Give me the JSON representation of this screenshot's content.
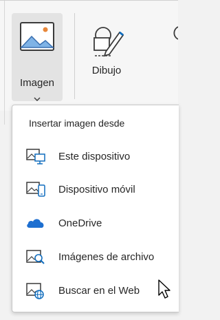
{
  "ribbon": {
    "imagen_label": "Imagen",
    "dibujo_label": "Dibujo"
  },
  "menu": {
    "header": "Insertar imagen desde",
    "items": [
      {
        "label": "Este dispositivo",
        "icon": "device-image-icon"
      },
      {
        "label": "Dispositivo móvil",
        "icon": "mobile-image-icon"
      },
      {
        "label": "OneDrive",
        "icon": "onedrive-cloud-icon"
      },
      {
        "label": "Imágenes de archivo",
        "icon": "stock-image-search-icon"
      },
      {
        "label": "Buscar en el Web",
        "icon": "web-image-icon"
      }
    ]
  },
  "colors": {
    "accent": "#0f6cbd",
    "onedrive": "#1e6fd0",
    "icon_gray": "#3a3a3a"
  }
}
